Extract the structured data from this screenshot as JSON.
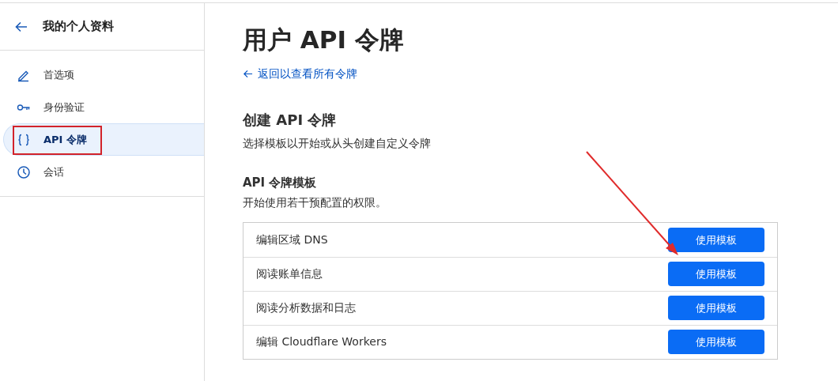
{
  "sidebar": {
    "title": "我的个人资料",
    "items": [
      {
        "label": "首选项",
        "selected": false
      },
      {
        "label": "身份验证",
        "selected": false
      },
      {
        "label": "API 令牌",
        "selected": true
      },
      {
        "label": "会话",
        "selected": false
      }
    ]
  },
  "main": {
    "title": "用户 API 令牌",
    "back_link": "返回以查看所有令牌",
    "section": {
      "title": "创建 API 令牌",
      "description": "选择模板以开始或从头创建自定义令牌"
    },
    "templates": {
      "title": "API 令牌模板",
      "description": "开始使用若干预配置的权限。",
      "rows": [
        {
          "name": "编辑区域 DNS",
          "button": "使用模板"
        },
        {
          "name": "阅读账单信息",
          "button": "使用模板"
        },
        {
          "name": "阅读分析数据和日志",
          "button": "使用模板"
        },
        {
          "name": "编辑 Cloudflare Workers",
          "button": "使用模板"
        }
      ]
    }
  }
}
